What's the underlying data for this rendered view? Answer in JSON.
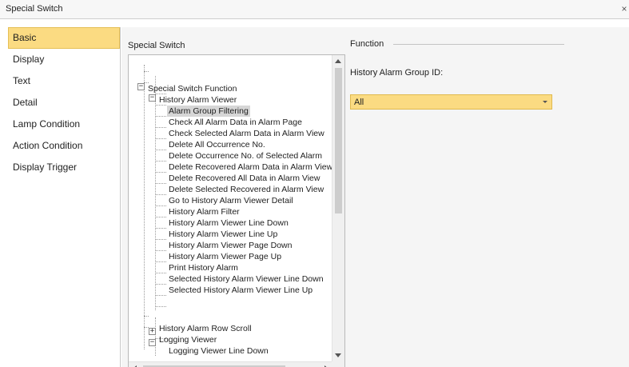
{
  "window": {
    "title": "Special Switch",
    "close_symbol": "×"
  },
  "sidebar": {
    "items": [
      {
        "label": "Basic",
        "active": true
      },
      {
        "label": "Display"
      },
      {
        "label": "Text"
      },
      {
        "label": "Detail"
      },
      {
        "label": "Lamp Condition"
      },
      {
        "label": "Action Condition"
      },
      {
        "label": "Display Trigger"
      }
    ]
  },
  "special_switch": {
    "label": "Special Switch",
    "tree": {
      "root": "Special Switch Function",
      "history_alarm_viewer": "History Alarm Viewer",
      "history_items": [
        "Alarm Group Filtering",
        "Check All Alarm Data in Alarm Page",
        "Check Selected Alarm Data in Alarm View",
        "Delete All Occurrence No.",
        "Delete Occurrence No. of Selected Alarm",
        "Delete Recovered Alarm Data in Alarm View",
        "Delete Recovered All Data in Alarm View",
        "Delete Selected Recovered in Alarm View",
        "Go to History Alarm Viewer Detail",
        "History Alarm Filter",
        "History Alarm Viewer Line Down",
        "History Alarm Viewer Line Up",
        "History Alarm Viewer Page Down",
        "History Alarm Viewer Page Up",
        "Print History Alarm",
        "Selected History Alarm Viewer Line Down",
        "Selected History Alarm Viewer Line Up"
      ],
      "selected_item": "Alarm Group Filtering",
      "history_alarm_row_scroll": "History Alarm Row Scroll",
      "logging_viewer": "Logging Viewer",
      "logging_items": [
        "Logging Viewer Line Down"
      ],
      "expanded_symbol": "−",
      "collapsed_symbol": "+"
    }
  },
  "function": {
    "label": "Function",
    "group_id_label": "History Alarm Group ID:",
    "group_id_value": "All"
  },
  "colors": {
    "accent": "#fbdb82",
    "accent_border": "#e0b94e",
    "selected_tree_bg": "#d6d6d6"
  }
}
